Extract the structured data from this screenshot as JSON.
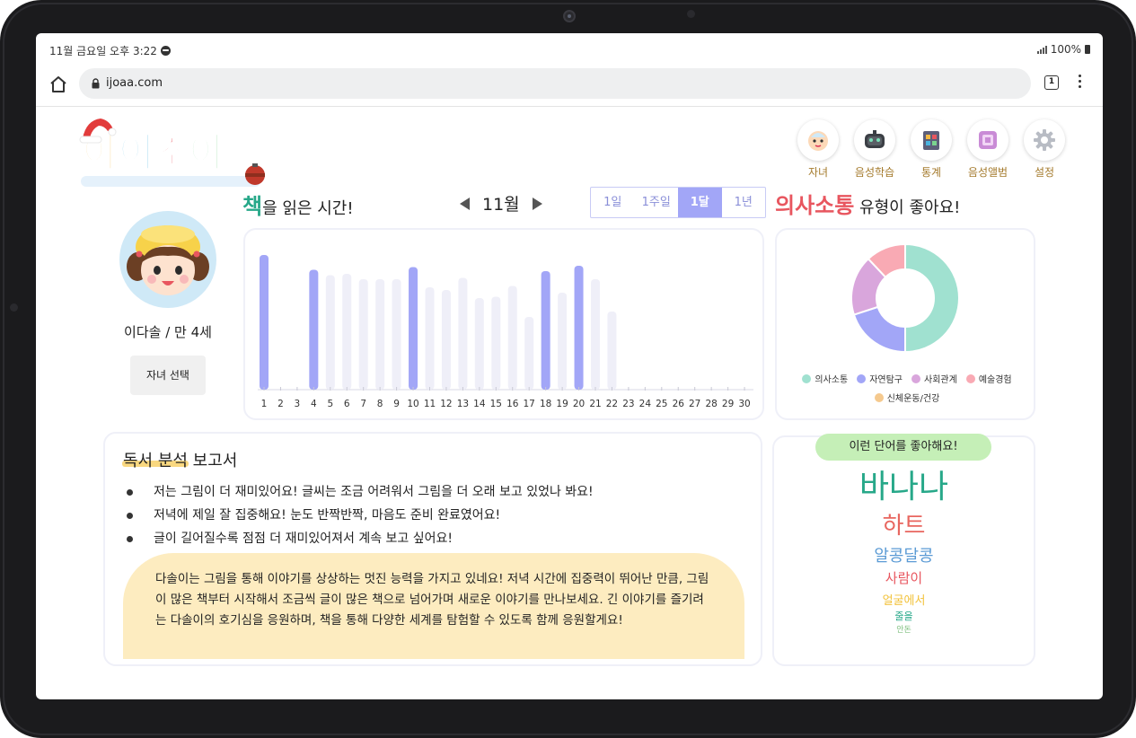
{
  "statusbar": {
    "time": "11월 금요일 오후 3:22",
    "battery": "100%"
  },
  "browser": {
    "url": "ijoaa.com",
    "tab_count": "1"
  },
  "logo": {
    "text": "아이조아"
  },
  "nav": {
    "items": [
      {
        "label": "자녀",
        "icon": "baby-face-icon"
      },
      {
        "label": "음성학습",
        "icon": "robot-icon"
      },
      {
        "label": "통계",
        "icon": "stats-board-icon"
      },
      {
        "label": "음성앨범",
        "icon": "album-icon"
      },
      {
        "label": "설정",
        "icon": "gear-icon"
      }
    ]
  },
  "profile": {
    "name": "이다솔 / 만 4세",
    "select_label": "자녀 선택"
  },
  "reading": {
    "title_accent": "책",
    "title_rest": "을 읽은 시간!",
    "month": "11월",
    "periods": [
      "1일",
      "1주일",
      "1달",
      "1년"
    ],
    "active_period": "1달"
  },
  "chart_data": {
    "type": "bar",
    "categories": [
      "1",
      "2",
      "3",
      "4",
      "5",
      "6",
      "7",
      "8",
      "9",
      "10",
      "11",
      "12",
      "13",
      "14",
      "15",
      "16",
      "17",
      "18",
      "19",
      "20",
      "21",
      "22",
      "23",
      "24",
      "25",
      "26",
      "27",
      "28",
      "29",
      "30"
    ],
    "values": [
      100,
      0,
      0,
      89,
      85,
      86,
      82,
      82,
      82,
      91,
      76,
      74,
      83,
      68,
      69,
      77,
      54,
      88,
      72,
      92,
      82,
      58,
      0,
      0,
      0,
      0,
      0,
      0,
      0,
      0
    ],
    "highlighted": [
      "1",
      "4",
      "10",
      "18",
      "20"
    ],
    "ylim": [
      0,
      100
    ],
    "colors": {
      "highlight": "#a2a6f7",
      "normal": "#efeff8"
    }
  },
  "communication": {
    "title_accent": "의사소통",
    "title_rest": " 유형이 좋아요!"
  },
  "donut_data": {
    "type": "pie",
    "slices": [
      {
        "name": "의사소통",
        "value": 50,
        "color": "#a0e1d0"
      },
      {
        "name": "자연탐구",
        "value": 20,
        "color": "#a2a6f7"
      },
      {
        "name": "사회관계",
        "value": 18,
        "color": "#d9a6dc"
      },
      {
        "name": "예술경험",
        "value": 12,
        "color": "#f9aab4"
      },
      {
        "name": "신체운동/건강",
        "value": 0,
        "color": "#f5c98e"
      }
    ]
  },
  "report": {
    "title": "독서 분석 보고서",
    "bullets": [
      "저는 그림이 더 재미있어요! 글씨는 조금 어려워서 그림을 더 오래 보고 있었나 봐요!",
      "저녁에 제일 잘 집중해요! 눈도 반짝반짝, 마음도 준비 완료였어요!",
      "글이 길어질수록 점점 더 재미있어져서 계속 보고 싶어요!"
    ],
    "summary": "다솔이는 그림을 통해 이야기를 상상하는 멋진 능력을 가지고 있네요! 저녁 시간에 집중력이 뛰어난 만큼, 그림이 많은 책부터 시작해서 조금씩 글이 많은 책으로 넘어가며 새로운 이야기를 만나보세요. 긴 이야기를 즐기려는 다솔이의 호기심을 응원하며, 책을 통해 다양한 세계를 탐험할 수 있도록 함께 응원할게요!"
  },
  "words": {
    "badge": "이런 단어를 좋아해요!",
    "list": [
      {
        "text": "바나나",
        "color": "#27a889"
      },
      {
        "text": "하트",
        "color": "#e8665f"
      },
      {
        "text": "알콩달콩",
        "color": "#5b9bd5"
      },
      {
        "text": "사람이",
        "color": "#e8565f"
      },
      {
        "text": "얼굴에서",
        "color": "#f2c23a"
      },
      {
        "text": "줄을",
        "color": "#27a889"
      },
      {
        "text": "안돈",
        "color": "#7fbf7f"
      }
    ]
  }
}
